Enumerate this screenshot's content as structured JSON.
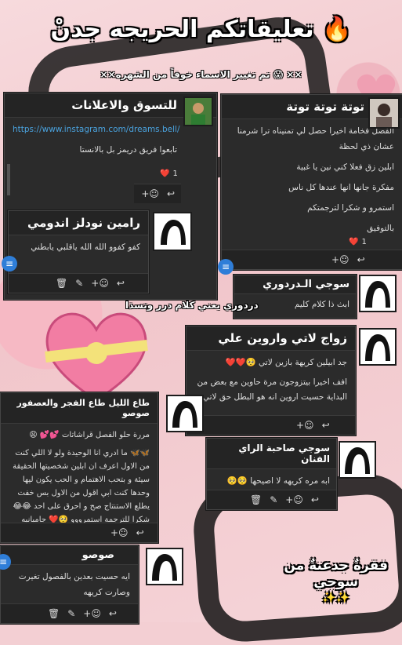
{
  "title": "تعليقاتكم الحريجه جدنْ 🔥",
  "subtitle": "××تم تغيير الاسماء خوفاً من الشهره 😱 ××",
  "cards": {
    "instagram": {
      "header": "للتسوق والاعلانات",
      "link": "https://www.instagram.com/dreams.bell/",
      "text": "تابعوا فريق دريمز بل بالانستا",
      "likes": "1"
    },
    "toota": {
      "header": "توتة توتة توتة",
      "lines": [
        "الفصل فخامة اخيرا حصل لي تمنيناه ترا شرمنا عشان ذي لحظة",
        "ابلين زق فعلا كني نين يا غبية",
        "مفكرة جانها انها عندها كل ناس",
        "استمرو و شكرا لترجمتكم",
        "بالتوفيق"
      ],
      "likes": "1"
    },
    "rameen": {
      "header": "رامين نودلز اندومي",
      "text": "كفو كفوو الله الله ياقلبي يابطني"
    },
    "sooji1": {
      "header": "سوجي الـدردوري",
      "text": "ابث ذا كلام كليم"
    },
    "zawaj": {
      "header": "زواج لاتي واروين علي",
      "lines": [
        "جد ابيلين كريهة بازين لاتي 🥺❤️❤️",
        "افف اخيرا بيتزوجون مرة حاوين مع بعض من البداية حسيت اروين انه هو البطل حق لاتي"
      ]
    },
    "talal": {
      "header": "طاع الليل طاع الفجر والعصفور صوصو",
      "lines": [
        "مررة حلو الفصل قراشاتات 💕💕 😩",
        "🦋🦋 ما ادري انا الوحيدة ولو لا اللي كنت من الاول اعرف ان ابلين شخصيتها الحقيقة سيئة و بتحب الاهتمام و الحب يكون ليها وحدها كنت ابي اقول من الاول بس خفت يطلع الاستنتاج صح و احرق على احد 😂😂 شكرا للترجمة استمرووو 🥺❤️ جامبانيه"
      ]
    },
    "sooji2": {
      "header": "سوجي صاحبة الراي الفنان",
      "text": "ابه مره كريهه لا اصيحها 🥺🥺"
    },
    "soso": {
      "header": "صوصو",
      "text": "ايه حسيت بعدين بالفصول تغيرت وصارت كريهه"
    }
  },
  "overlay": "دردوري يعني كلام درر وتسذا",
  "signature": {
    "line1": "فقرةٌ جدعنةٌ من",
    "line2": "سوجي",
    "sparkles": "✨✨"
  },
  "colors": {
    "accent": "#2f7ed8",
    "card": "#2b2b2b",
    "link": "#4aa3df"
  }
}
